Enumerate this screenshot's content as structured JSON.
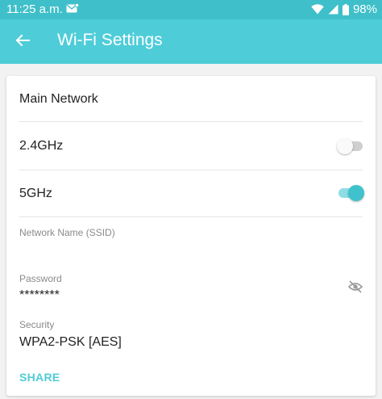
{
  "status_bar": {
    "time": "11:25 a.m.",
    "notification_icon": "notification-icon",
    "wifi_icon": "wifi-icon",
    "battery_icon": "battery-icon",
    "battery_level": "98%"
  },
  "app_bar": {
    "back_icon": "arrow-left-icon",
    "title": "Wi-Fi Settings"
  },
  "main_network": {
    "title": "Main Network",
    "band_24": {
      "label": "2.4GHz",
      "enabled": false
    },
    "band_5": {
      "label": "5GHz",
      "enabled": true
    },
    "ssid": {
      "label": "Network Name (SSID)",
      "value": ""
    },
    "password": {
      "label": "Password",
      "value": "********",
      "visibility_icon": "eye-off-icon"
    },
    "security": {
      "label": "Security",
      "value": "WPA2-PSK [AES]"
    },
    "share_label": "SHARE"
  },
  "colors": {
    "accent": "#4ecdd9",
    "status_bar": "#3fbfc9",
    "toggle_on": "#3fc2cc"
  }
}
